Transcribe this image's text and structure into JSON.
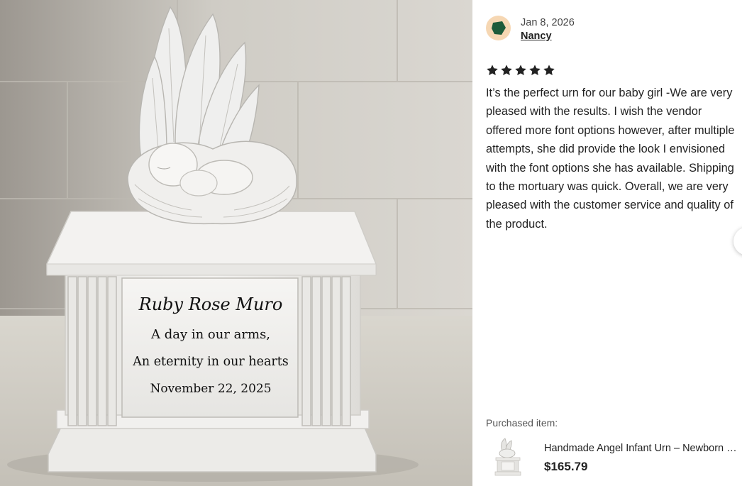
{
  "photo": {
    "plaque_name": "Ruby Rose Muro",
    "plaque_line1": "A day in our arms,",
    "plaque_line2": "An eternity in our hearts",
    "plaque_date": "November 22, 2025"
  },
  "review": {
    "date": "Jan 8, 2026",
    "reviewer_name": "Nancy",
    "rating": 5,
    "text": "It’s the perfect urn for our baby girl -We are very pleased with the results. I wish the vendor offered more font options however, after multiple attempts, she did provide the look I envisioned with the font options she has available. Shipping to the mortuary was quick. Overall, we are very pleased with the customer service and quality of the product."
  },
  "purchased": {
    "label": "Purchased item:",
    "title": "Handmade Angel Infant Urn – Newborn Memorial Keepsake",
    "price": "$165.79"
  },
  "icons": {
    "star": "star-icon",
    "next": "chevron-right-icon"
  },
  "colors": {
    "star": "#222222",
    "avatar_bg": "#f6d7b3",
    "avatar_shape": "#1e5b3a"
  }
}
